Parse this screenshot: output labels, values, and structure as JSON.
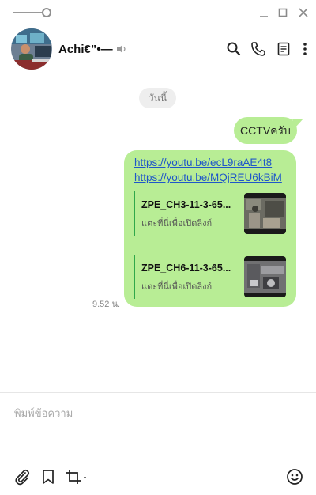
{
  "window": {
    "controls": [
      "minimize-icon",
      "maximize-icon",
      "close-icon"
    ]
  },
  "header": {
    "contact_name": "Achi€”•—",
    "icons": [
      "search-icon",
      "phone-icon",
      "notes-icon",
      "more-icon"
    ]
  },
  "chat": {
    "date_label": "วันนี้",
    "messages": [
      {
        "type": "text",
        "text": "CCTVครับ"
      },
      {
        "type": "links",
        "links": [
          "https://youtu.be/ecL9raAE4t8",
          "https://youtu.be/MQjREU6kBiM"
        ],
        "previews": [
          {
            "title": "ZPE_CH3-11-3-65...",
            "subtitle": "แตะที่นี่เพื่อเปิดลิงก์"
          },
          {
            "title": "ZPE_CH6-11-3-65...",
            "subtitle": "แตะที่นี่เพื่อเปิดลิงก์"
          }
        ],
        "time": "9.52 น."
      }
    ]
  },
  "composer": {
    "placeholder": "พิมพ์ข้อความ",
    "icons": [
      "attach-icon",
      "bookmark-icon",
      "crop-icon",
      "emoji-icon"
    ]
  },
  "colors": {
    "bubble": "#b8ed95",
    "link": "#1f57c9",
    "preview_bar": "#2fa84a"
  }
}
